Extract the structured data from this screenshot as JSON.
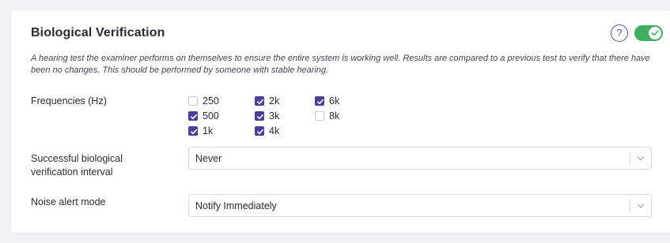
{
  "section": {
    "title": "Biological Verification",
    "description": "A hearing test the examiner performs on themselves to ensure the entire system is working well. Results are compared to a previous test to verify that there have been no changes. This should be performed by someone with stable hearing.",
    "help_icon": "question-circle-icon",
    "help_symbol": "?",
    "toggle_enabled": true,
    "accent_color": "#4c3f96",
    "toggle_color": "#3fae5e"
  },
  "frequencies": {
    "label": "Frequencies (Hz)",
    "options": [
      {
        "label": "250",
        "checked": false
      },
      {
        "label": "2k",
        "checked": true
      },
      {
        "label": "6k",
        "checked": true
      },
      {
        "label": "500",
        "checked": true
      },
      {
        "label": "3k",
        "checked": true
      },
      {
        "label": "8k",
        "checked": false
      },
      {
        "label": "1k",
        "checked": true
      },
      {
        "label": "4k",
        "checked": true
      }
    ]
  },
  "interval": {
    "label": "Successful biological verification interval",
    "value": "Never"
  },
  "noise_alert": {
    "label": "Noise alert mode",
    "value": "Notify Immediately"
  }
}
